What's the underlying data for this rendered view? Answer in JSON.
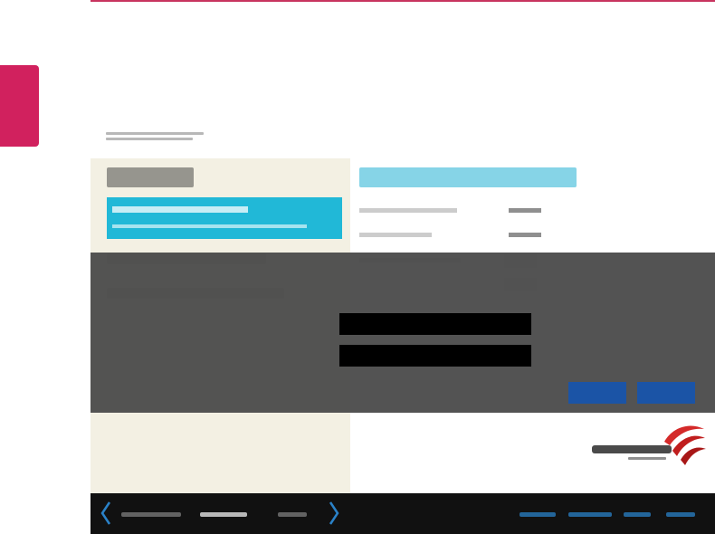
{
  "colors": {
    "accent_crimson": "#d1215e",
    "selection_cyan": "#21b8d7",
    "dialog_gray": "#4c4c4c",
    "button_blue": "#1b54a6",
    "footer_black": "#111111"
  },
  "icons": {
    "footer_prev": "chevron-left-icon",
    "footer_next": "chevron-right-icon",
    "brand": "phoenix-logo"
  },
  "dialog": {
    "password_input_value": "",
    "confirm_input_value": ""
  }
}
